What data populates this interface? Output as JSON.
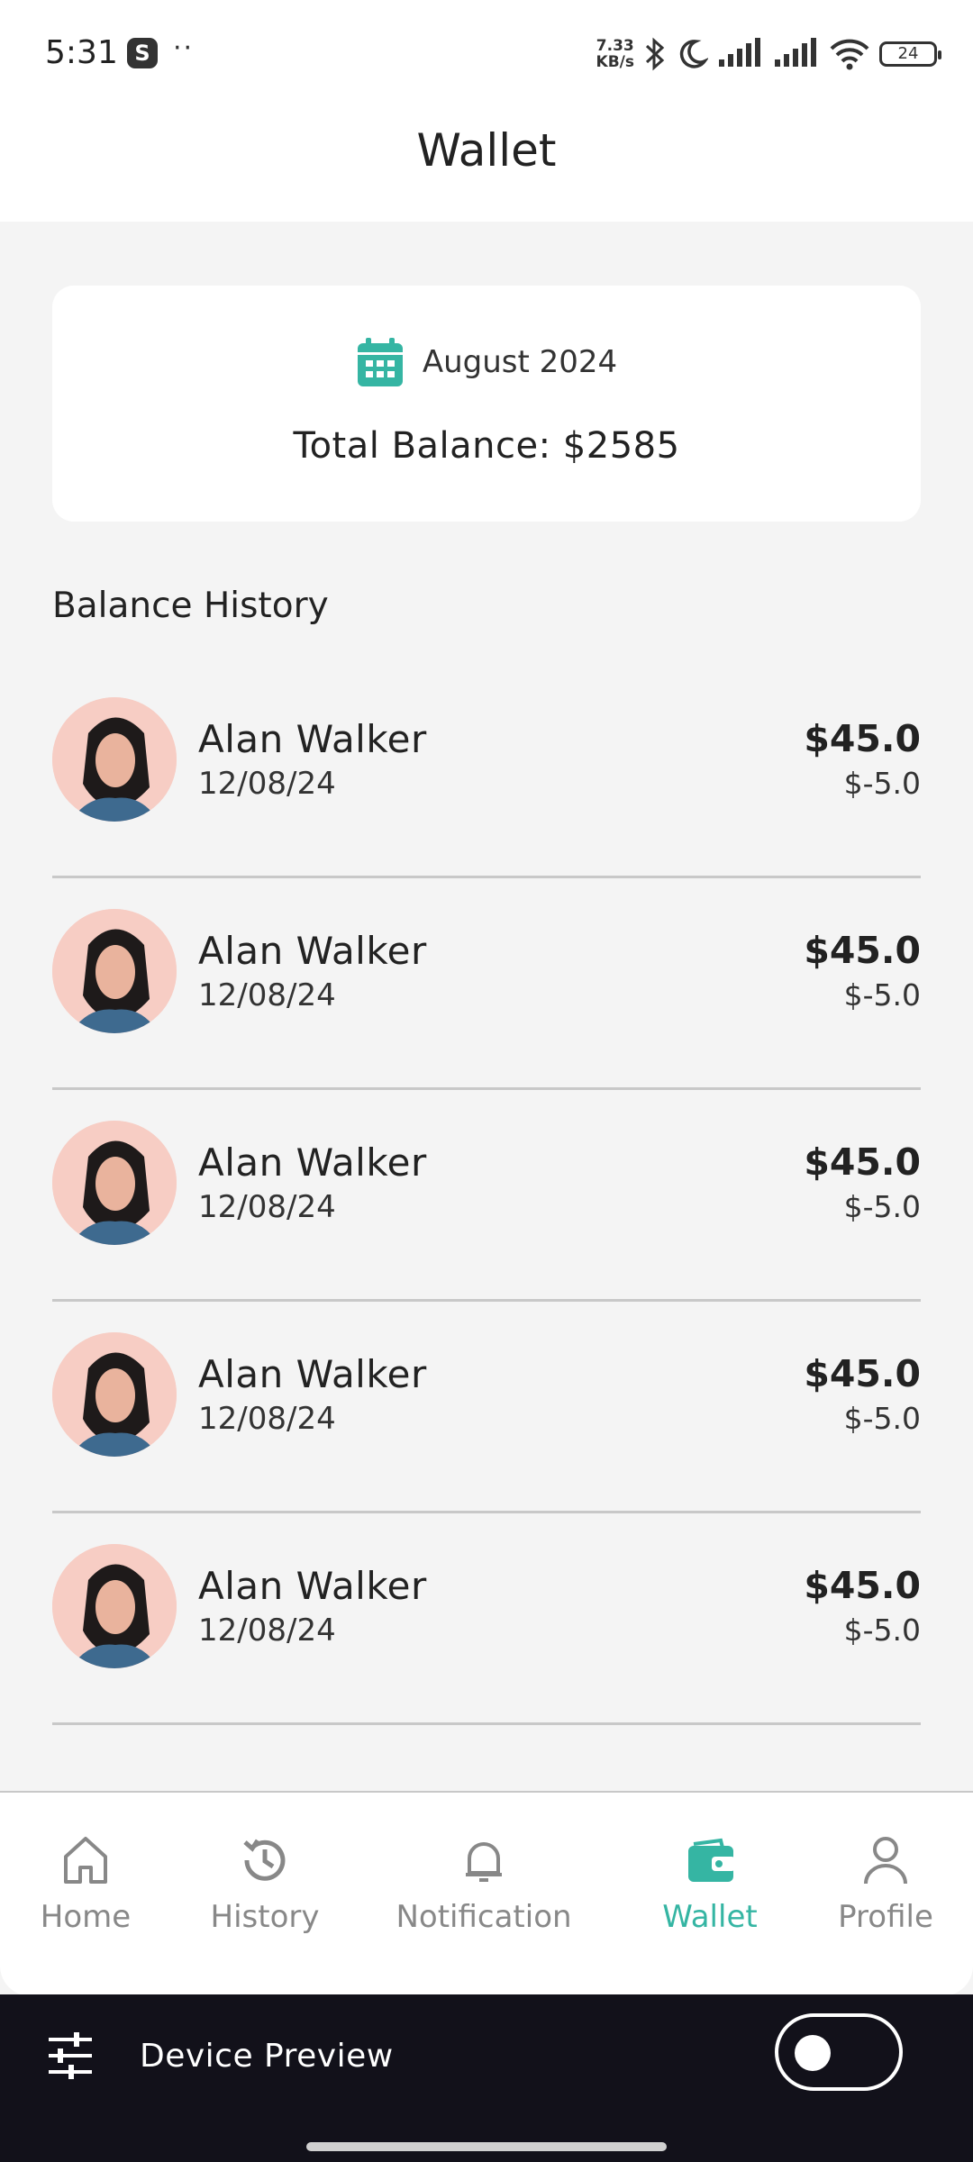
{
  "status_bar": {
    "time": "5:31",
    "app_icon": "S",
    "dots": "··",
    "speed_value": "7.33",
    "speed_unit": "KB/s",
    "battery": "24"
  },
  "header": {
    "title": "Wallet"
  },
  "balance_card": {
    "month": "August 2024",
    "total": "Total Balance: $2585",
    "icon": "calendar-icon",
    "accent": "#35b5a3"
  },
  "history": {
    "title": "Balance History",
    "items": [
      {
        "name": "Alan Walker",
        "date": "12/08/24",
        "amount": "$45.0",
        "fee": "$-5.0"
      },
      {
        "name": "Alan Walker",
        "date": "12/08/24",
        "amount": "$45.0",
        "fee": "$-5.0"
      },
      {
        "name": "Alan Walker",
        "date": "12/08/24",
        "amount": "$45.0",
        "fee": "$-5.0"
      },
      {
        "name": "Alan Walker",
        "date": "12/08/24",
        "amount": "$45.0",
        "fee": "$-5.0"
      },
      {
        "name": "Alan Walker",
        "date": "12/08/24",
        "amount": "$45.0",
        "fee": "$-5.0"
      }
    ]
  },
  "nav": {
    "items": [
      {
        "label": "Home",
        "icon": "home-icon",
        "active": false
      },
      {
        "label": "History",
        "icon": "history-icon",
        "active": false
      },
      {
        "label": "Notification",
        "icon": "bell-icon",
        "active": false
      },
      {
        "label": "Wallet",
        "icon": "wallet-icon",
        "active": true
      },
      {
        "label": "Profile",
        "icon": "person-icon",
        "active": false
      }
    ],
    "active_color": "#35b5a3",
    "inactive_color": "#888888"
  },
  "device_preview": {
    "label": "Device Preview",
    "toggle_on": false
  }
}
